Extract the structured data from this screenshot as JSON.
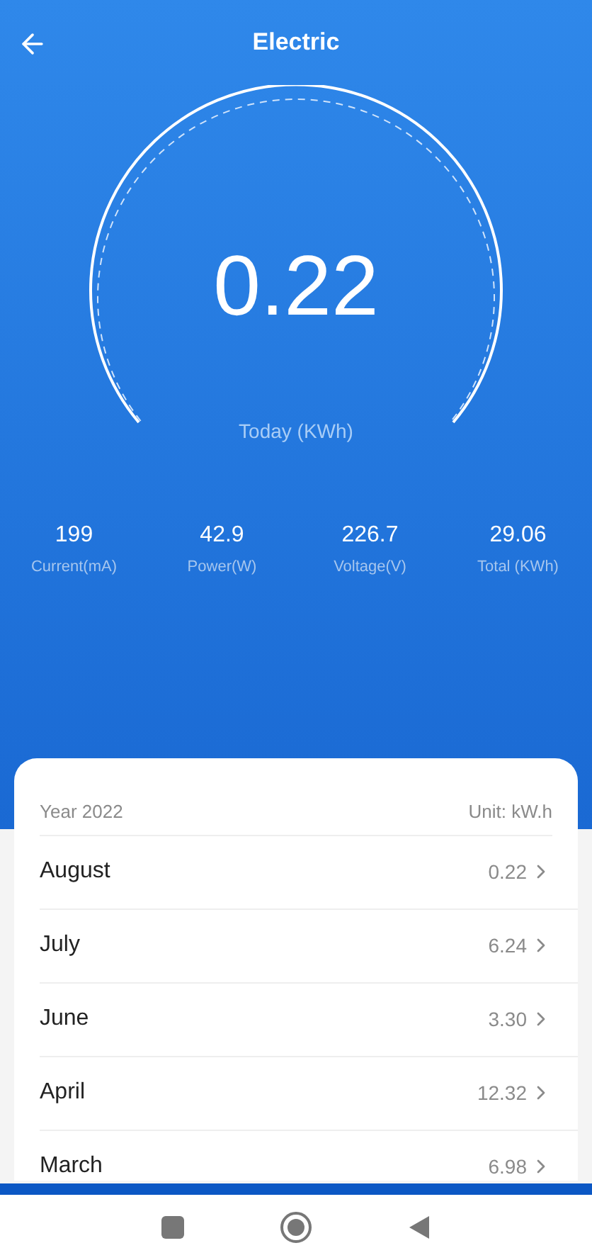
{
  "header": {
    "title": "Electric"
  },
  "gauge": {
    "value": "0.22",
    "label": "Today (KWh)"
  },
  "stats": [
    {
      "value": "199",
      "label": "Current(mA)"
    },
    {
      "value": "42.9",
      "label": "Power(W)"
    },
    {
      "value": "226.7",
      "label": "Voltage(V)"
    },
    {
      "value": "29.06",
      "label": "Total (KWh)"
    }
  ],
  "list": {
    "year": "Year 2022",
    "unit": "Unit: kW.h",
    "rows": [
      {
        "month": "August",
        "value": "0.22"
      },
      {
        "month": "July",
        "value": "6.24"
      },
      {
        "month": "June",
        "value": "3.30"
      },
      {
        "month": "April",
        "value": "12.32"
      },
      {
        "month": "March",
        "value": "6.98"
      }
    ]
  }
}
